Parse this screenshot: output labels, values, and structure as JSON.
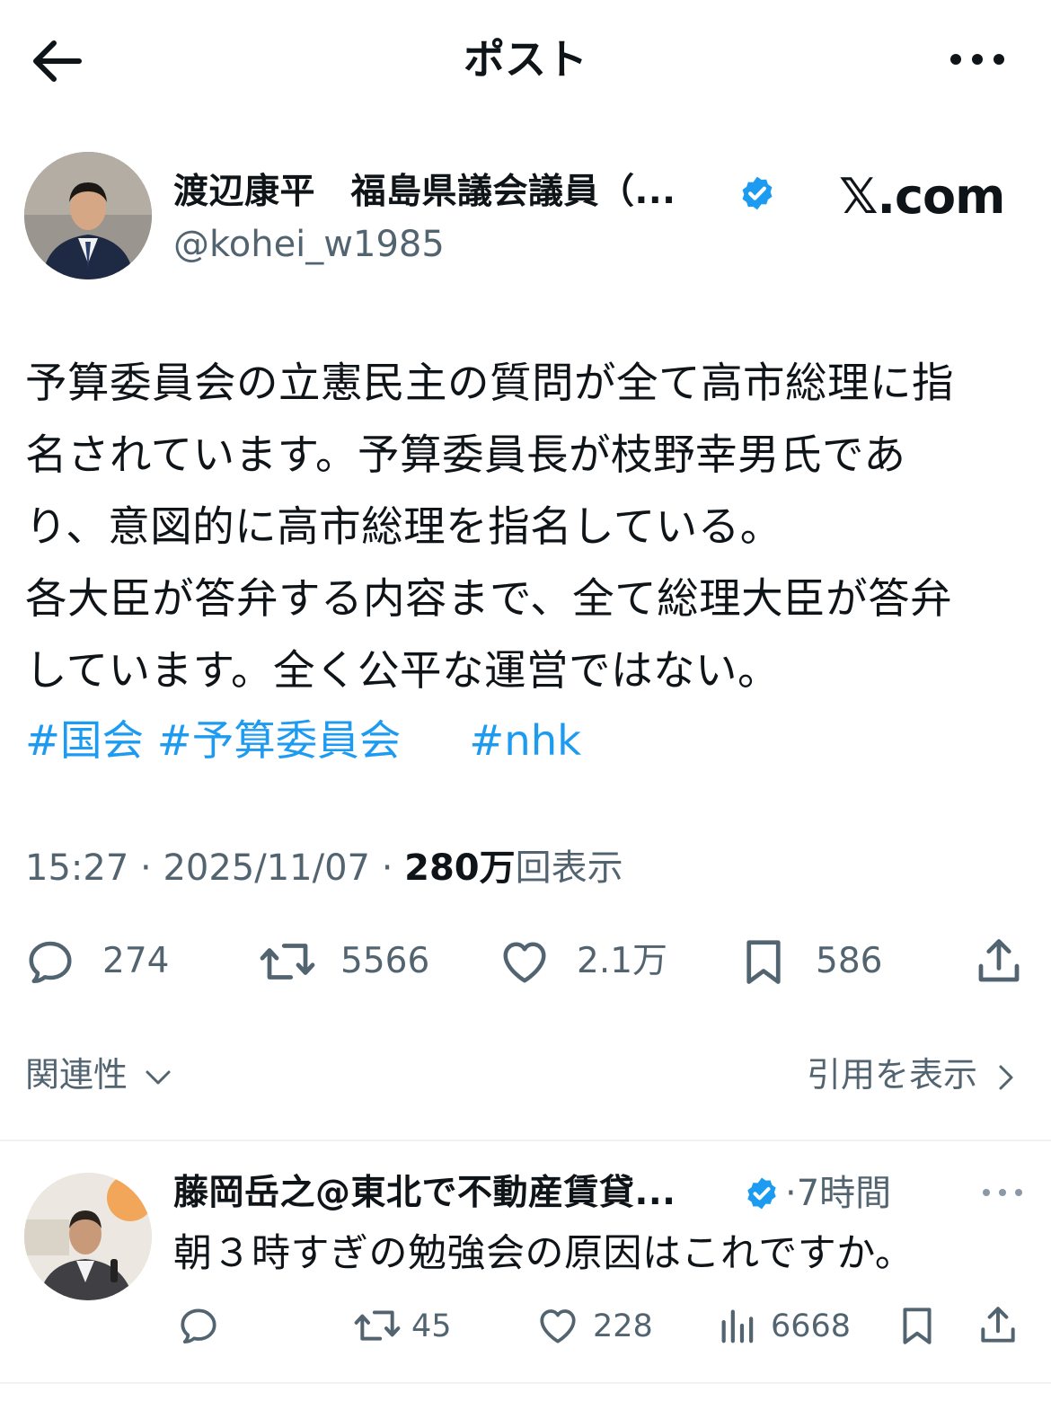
{
  "header": {
    "title": "ポスト",
    "back_icon": "arrow-left-icon",
    "more_icon": "more-horizontal-icon"
  },
  "author": {
    "name": "渡辺康平　福島県議会議員（...",
    "handle": "@kohei_w1985",
    "verified": true,
    "verified_color": "#1d9bf0"
  },
  "source_badge": "𝕏.com",
  "post": {
    "text": "予算委員会の立憲民主の質問が全て高市総理に指\n名されています。予算委員長が枝野幸男氏であ\nり、意図的に高市総理を指名している。\n各大臣が答弁する内容まで、全て総理大臣が答弁\nしています。全く公平な運営ではない。",
    "hashtags": [
      "#国会",
      "#予算委員会",
      "#nhk"
    ],
    "hashtag_color": "#1d9bf0"
  },
  "meta": {
    "time": "15:27",
    "sep1": " · ",
    "date": "2025/11/07",
    "sep2": " · ",
    "views": "280万",
    "views_label": "回表示"
  },
  "actions": {
    "replies": "274",
    "reposts": "5566",
    "likes": "2.1万",
    "bookmarks": "586"
  },
  "footer": {
    "relevance_label": "関連性",
    "quotes_label": "引用を表示"
  },
  "reply": {
    "name": "藤岡岳之@東北で不動産賃貸...",
    "verified": true,
    "time": "·7時間",
    "text": "朝３時すぎの勉強会の原因はこれですか。",
    "reposts": "45",
    "likes": "228",
    "views": "6668"
  },
  "colors": {
    "text_primary": "#0f1419",
    "text_secondary": "#536471",
    "accent": "#1d9bf0",
    "divider": "#eff3f4"
  }
}
